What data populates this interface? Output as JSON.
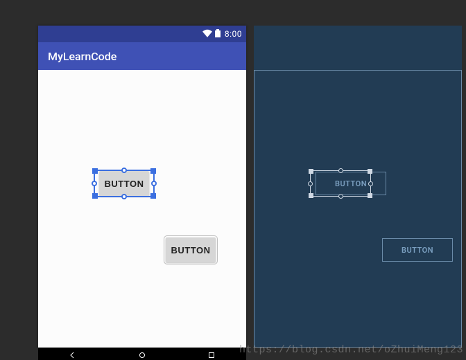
{
  "statusbar": {
    "time": "8:00"
  },
  "toolbar": {
    "title": "MyLearnCode"
  },
  "buttons": {
    "btn1": {
      "label": "BUTTON"
    },
    "btn2": {
      "label": "BUTTON"
    }
  },
  "blueprint_buttons": {
    "btn1": {
      "label": "BUTTON"
    },
    "btn2": {
      "label": "BUTTON"
    }
  },
  "watermark": "https://blog.csdn.net/oZhuiMeng123",
  "colors": {
    "primary": "#3f51b5",
    "primary_dark": "#2f3e92",
    "blueprint_bg": "#223c54",
    "selection": "#3b6fe0"
  }
}
